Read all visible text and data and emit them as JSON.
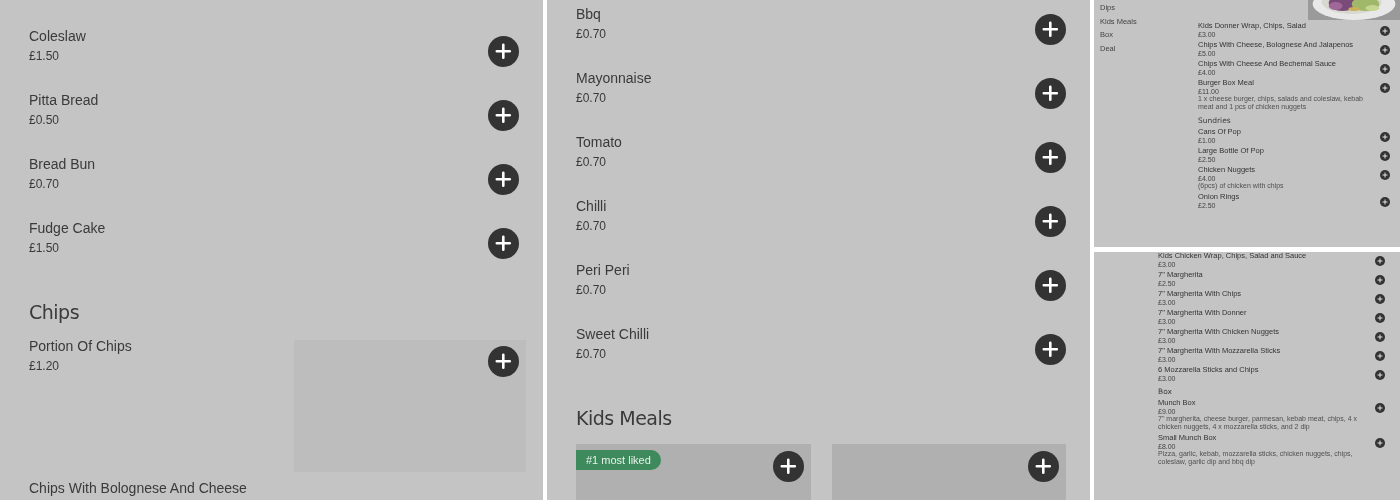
{
  "panels": [
    {
      "kind": "wide",
      "blocks": [
        {
          "kind": "item",
          "name": "Coleslaw",
          "price": "£1.50"
        },
        {
          "kind": "item",
          "name": "Pitta Bread",
          "price": "£0.50"
        },
        {
          "kind": "item",
          "name": "Bread Bun",
          "price": "£0.70"
        },
        {
          "kind": "item",
          "name": "Fudge Cake",
          "price": "£1.50"
        },
        {
          "kind": "heading",
          "text": "Chips"
        },
        {
          "kind": "image_item",
          "name": "Portion Of Chips",
          "price": "£1.20"
        },
        {
          "kind": "name_only",
          "name": "Chips With Bolognese And Cheese"
        }
      ]
    },
    {
      "kind": "wide",
      "blocks": [
        {
          "kind": "item",
          "name": "Bbq",
          "price": "£0.70"
        },
        {
          "kind": "item",
          "name": "Mayonnaise",
          "price": "£0.70"
        },
        {
          "kind": "item",
          "name": "Tomato",
          "price": "£0.70"
        },
        {
          "kind": "item",
          "name": "Chilli",
          "price": "£0.70"
        },
        {
          "kind": "item",
          "name": "Peri Peri",
          "price": "£0.70"
        },
        {
          "kind": "item",
          "name": "Sweet Chilli",
          "price": "£0.70"
        },
        {
          "kind": "heading",
          "text": "Kids Meals"
        },
        {
          "kind": "cards",
          "cards": [
            {
              "kind": "card",
              "badge": "#1 most liked"
            },
            {
              "kind": "card"
            }
          ]
        }
      ]
    },
    {
      "kind": "narrow",
      "nav": [
        "Dips",
        "Kids Meals",
        "Box",
        "Deal"
      ],
      "blocks": [
        {
          "kind": "picture"
        },
        {
          "kind": "item",
          "name": "Kids Donner Wrap, Chips, Salad",
          "price": "£3.00"
        },
        {
          "kind": "item",
          "name": "Chips With Cheese, Bolognese And Jalapenos",
          "price": "£5.00"
        },
        {
          "kind": "item",
          "name": "Chips With Cheese And Bechemal Sauce",
          "price": "£4.00"
        },
        {
          "kind": "item",
          "name": "Burger Box Meal",
          "price": "£11.00",
          "description": "1 x cheese burger, chips, salads and coleslaw, kebab meat and 1 pcs of chicken nuggets"
        },
        {
          "kind": "heading",
          "text": "Sundries"
        },
        {
          "kind": "item",
          "name": "Cans Of Pop",
          "price": "£1.00"
        },
        {
          "kind": "item",
          "name": "Large Bottle Of Pop",
          "price": "£2.50"
        },
        {
          "kind": "item",
          "name": "Chicken Nuggets",
          "price": "£4.00",
          "description": "(6pcs) of chicken with chips"
        },
        {
          "kind": "item",
          "name": "Onion Rings",
          "price": "£2.50"
        }
      ]
    },
    {
      "kind": "narrow",
      "blocks": [
        {
          "kind": "item",
          "name": "Kids Chicken Wrap, Chips, Salad and Sauce",
          "price": "£3.00"
        },
        {
          "kind": "item",
          "name": "7\" Margherita",
          "price": "£2.50"
        },
        {
          "kind": "item",
          "name": "7\" Margherita With Chips",
          "price": "£3.00"
        },
        {
          "kind": "item",
          "name": "7\" Margherita With Donner",
          "price": "£3.00"
        },
        {
          "kind": "item",
          "name": "7\" Margherita With Chicken Nuggets",
          "price": "£3.00"
        },
        {
          "kind": "item",
          "name": "7\" Margherita With Mozzarella Sticks",
          "price": "£3.00"
        },
        {
          "kind": "item",
          "name": "6 Mozzarella Sticks and Chips",
          "price": "£3.00"
        },
        {
          "kind": "heading",
          "text": "Box"
        },
        {
          "kind": "item",
          "name": "Munch Box",
          "price": "£9.00",
          "description": "7\" margherita, cheese burger, parmesan, kebab meat, chips, 4 x chicken nuggets, 4 x mozzarella sticks, and 2 dip"
        },
        {
          "kind": "item",
          "name": "Small Munch Box",
          "price": "£8.00",
          "description": "Pizza, garlic, kebab, mozzarella sticks, chicken nuggets, chips, coleslaw, garlic dip and bbq dip"
        }
      ]
    }
  ]
}
